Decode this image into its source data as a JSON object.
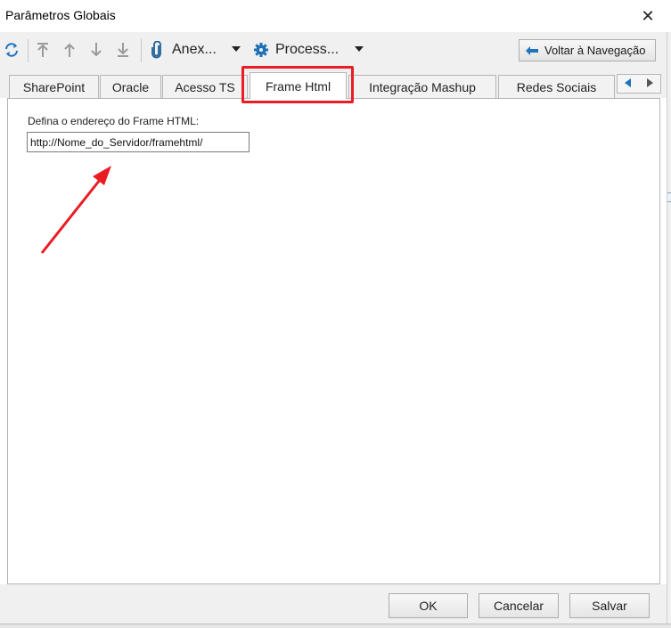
{
  "window": {
    "title": "Parâmetros Globais",
    "close_glyph": "✕"
  },
  "toolbar": {
    "anexos_label": "Anex...",
    "processos_label": "Process...",
    "back_label": "Voltar à Navegação",
    "icons": [
      "refresh-icon",
      "move-top-icon",
      "move-up-icon",
      "move-down-icon",
      "move-bottom-icon",
      "paperclip-icon",
      "gear-icon",
      "back-arrow-icon"
    ]
  },
  "tabs": [
    {
      "label": "SharePoint"
    },
    {
      "label": "Oracle"
    },
    {
      "label": "Acesso TS"
    },
    {
      "label": "Frame Html",
      "active": true
    },
    {
      "label": "Integração Mashup"
    },
    {
      "label": "Redes Sociais"
    }
  ],
  "form": {
    "label": "Defina o endereço do Frame HTML:",
    "value": "http://Nome_do_Servidor/framehtml/"
  },
  "footer": {
    "ok_label": "OK",
    "cancel_label": "Cancelar",
    "save_label": "Salvar"
  },
  "colors": {
    "accent_blue": "#1e73be",
    "annotation_red": "#ea1c24",
    "chrome": "#f0f0f0",
    "border": "#b5b5b5"
  }
}
